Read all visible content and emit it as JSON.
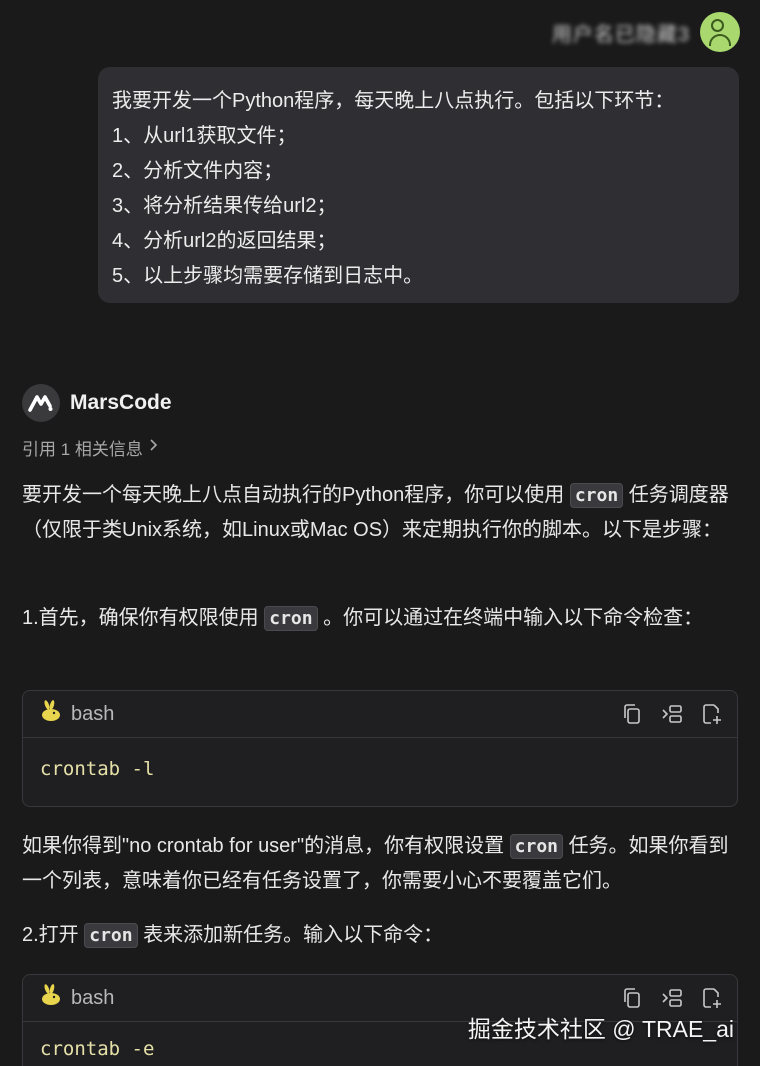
{
  "user": {
    "name": "用户名已隐藏3",
    "avatar_icon": "user-avatar-icon",
    "avatar_color": "#a8d86e"
  },
  "prompt": {
    "lines": [
      "我要开发一个Python程序，每天晚上八点执行。包括以下环节：",
      "1、从url1获取文件；",
      "2、分析文件内容；",
      "3、将分析结果传给url2；",
      "4、分析url2的返回结果；",
      "5、以上步骤均需要存储到日志中。"
    ]
  },
  "assistant": {
    "name": "MarsCode",
    "references_label": "引用 1 相关信息",
    "intro": {
      "part1": "要开发一个每天晚上八点自动执行的Python程序，你可以使用",
      "code": "cron",
      "part2": "任务调度器（仅限于类Unix系统，如Linux或Mac OS）来定期执行你的脚本。以下是步骤："
    },
    "step1": {
      "part1": "1.首先，确保你有权限使用",
      "code": "cron",
      "part2": "。你可以通过在终端中输入以下命令检查："
    },
    "code1": {
      "lang": "bash",
      "code": "crontab -l"
    },
    "note": {
      "part1": "如果你得到\"no crontab for user\"的消息，你有权限设置",
      "code": "cron",
      "part2": "任务。如果你看到一个列表，意味着你已经有任务设置了，你需要小心不要覆盖它们。"
    },
    "step2": {
      "part1": "2.打开",
      "code": "cron",
      "part2": "表来添加新任务。输入以下命令："
    },
    "code2": {
      "lang": "bash",
      "code": "crontab -e"
    }
  },
  "watermark": "掘金技术社区 @ TRAE_ai"
}
